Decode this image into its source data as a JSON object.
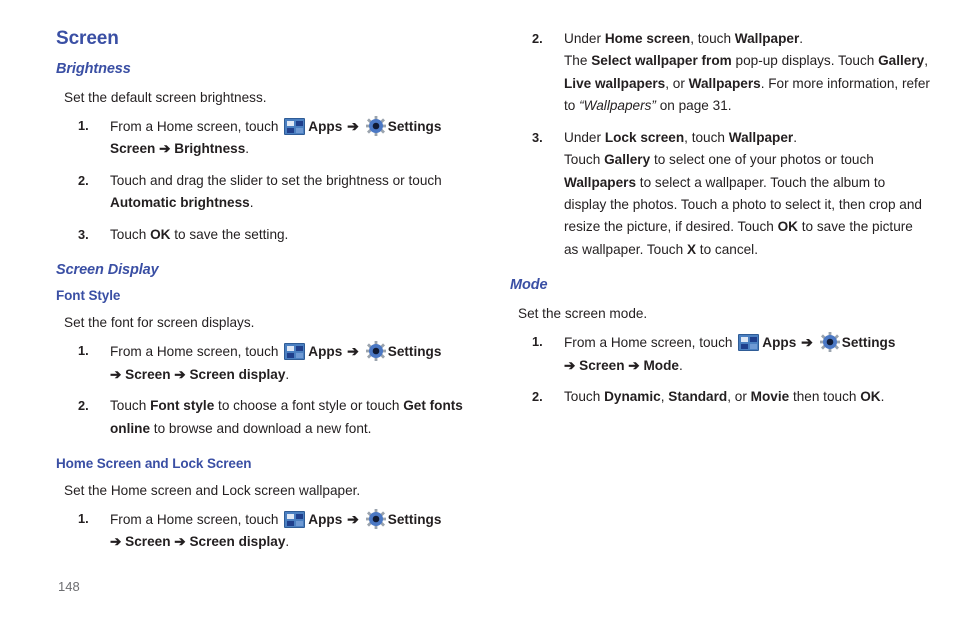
{
  "page": {
    "folio": "148",
    "accent_color": "#3a4fa4",
    "body_color": "#231f20",
    "icons": {
      "apps": "apps-grid-icon",
      "settings": "settings-gear-icon",
      "arrow": "➔"
    }
  },
  "left_column": {
    "title": "Screen",
    "sections": [
      {
        "heading": "Brightness",
        "heading_style": "italic",
        "lead": "Set the default screen brightness.",
        "steps": [
          {
            "num": "1.",
            "parts_a": [
              "From a Home screen, touch ",
              "Apps",
              " ➔ ",
              "Settings"
            ],
            "pre_apps": "From a Home screen, touch ",
            "apps_label": "Apps",
            "settings_label": "Settings",
            "cont": "➔ Screen ➔ Brightness.",
            "cont_bold": "Screen ➔ Brightness",
            "cont_tail": "."
          },
          {
            "num": "2.",
            "text_1": "Touch and drag the slider to set the brightness or touch ",
            "bold_1": "Automatic brightness",
            "text_2": "."
          },
          {
            "num": "3.",
            "text_1": "Touch ",
            "bold_1": "OK",
            "text_2": " to save the setting."
          }
        ]
      },
      {
        "heading": "Screen Display",
        "heading_style": "italic",
        "subheading": "Font Style",
        "lead": "Set the font for screen displays.",
        "steps": [
          {
            "num": "1.",
            "pre_apps": "From a Home screen, touch ",
            "apps_label": "Apps",
            "settings_label": "Settings",
            "cont_bold": "➔ Screen ➔ Screen display",
            "cont_tail": "."
          },
          {
            "num": "2.",
            "text_1": "Touch ",
            "bold_1": "Font style",
            "text_2": " to choose a font style or touch ",
            "bold_2": "Get fonts online",
            "text_3": " to browse and download a new font."
          }
        ]
      },
      {
        "subheading": "Home Screen and Lock Screen",
        "lead": "Set the Home screen and Lock screen wallpaper.",
        "steps": [
          {
            "num": "1.",
            "pre_apps": "From a Home screen, touch ",
            "apps_label": "Apps",
            "settings_label": "Settings",
            "cont_bold": "➔ Screen ➔ Screen display",
            "cont_tail": "."
          }
        ]
      }
    ]
  },
  "right_column": {
    "continued_steps": [
      {
        "num": "2.",
        "line1_pre": "Under ",
        "line1_b1": "Home screen",
        "line1_mid": ", touch ",
        "line1_b2": "Wallpaper",
        "line1_end": ".",
        "body_pre": "The ",
        "body_b1": "Select wallpaper from",
        "body_mid1": " pop-up displays. Touch ",
        "body_b2": "Gallery",
        "body_mid2": ", ",
        "body_b3": "Live wallpapers",
        "body_mid3": ", or ",
        "body_b4": "Wallpapers",
        "body_mid4": ". For more information, refer to ",
        "body_italic": "“Wallpapers”",
        "body_end": "  on page 31."
      },
      {
        "num": "3.",
        "line1_pre": "Under ",
        "line1_b1": "Lock screen",
        "line1_mid": ", touch ",
        "line1_b2": "Wallpaper",
        "line1_end": ".",
        "body_pre": "Touch ",
        "body_b1": "Gallery",
        "body_mid1": " to select one of your photos or touch ",
        "body_b2": "Wallpapers",
        "body_mid2": " to select a wallpaper. Touch the album to display the photos. Touch a photo to select it, then crop and resize the picture, if desired. Touch ",
        "body_b3": "OK",
        "body_mid3": " to save the picture as wallpaper. Touch ",
        "body_b4": "X",
        "body_end": " to cancel."
      }
    ],
    "mode_section": {
      "heading": "Mode",
      "heading_style": "italic",
      "lead": "Set the screen mode.",
      "steps": [
        {
          "num": "1.",
          "pre_apps": "From a Home screen, touch ",
          "apps_label": "Apps",
          "settings_label": "Settings",
          "cont_bold": "➔ Screen ➔ Mode",
          "cont_tail": "."
        },
        {
          "num": "2.",
          "text_1": "Touch ",
          "bold_1": "Dynamic",
          "text_2": ", ",
          "bold_2": "Standard",
          "text_3": ", or ",
          "bold_3": "Movie",
          "text_4": " then touch ",
          "bold_4": "OK",
          "text_5": "."
        }
      ]
    }
  }
}
